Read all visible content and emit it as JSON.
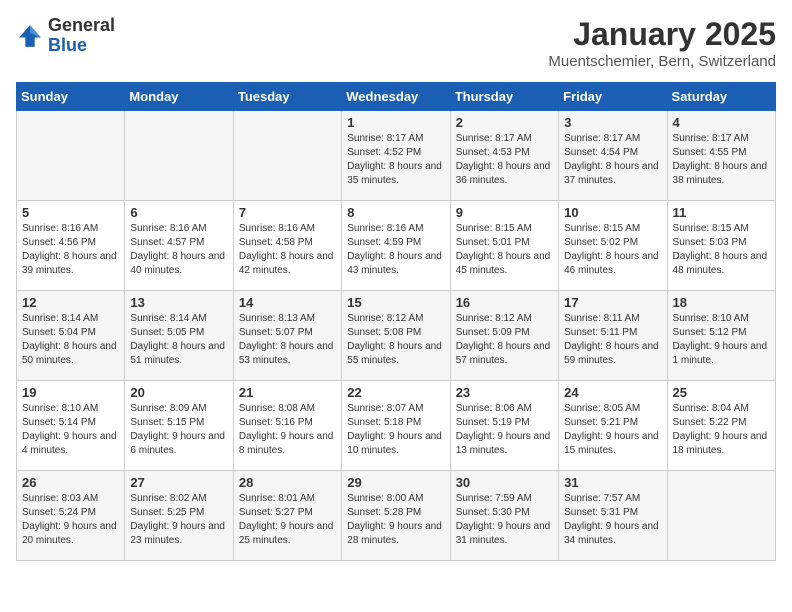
{
  "header": {
    "logo_general": "General",
    "logo_blue": "Blue",
    "month_title": "January 2025",
    "location": "Muentschemier, Bern, Switzerland"
  },
  "weekdays": [
    "Sunday",
    "Monday",
    "Tuesday",
    "Wednesday",
    "Thursday",
    "Friday",
    "Saturday"
  ],
  "weeks": [
    [
      {
        "day": "",
        "sunrise": "",
        "sunset": "",
        "daylight": ""
      },
      {
        "day": "",
        "sunrise": "",
        "sunset": "",
        "daylight": ""
      },
      {
        "day": "",
        "sunrise": "",
        "sunset": "",
        "daylight": ""
      },
      {
        "day": "1",
        "sunrise": "Sunrise: 8:17 AM",
        "sunset": "Sunset: 4:52 PM",
        "daylight": "Daylight: 8 hours and 35 minutes."
      },
      {
        "day": "2",
        "sunrise": "Sunrise: 8:17 AM",
        "sunset": "Sunset: 4:53 PM",
        "daylight": "Daylight: 8 hours and 36 minutes."
      },
      {
        "day": "3",
        "sunrise": "Sunrise: 8:17 AM",
        "sunset": "Sunset: 4:54 PM",
        "daylight": "Daylight: 8 hours and 37 minutes."
      },
      {
        "day": "4",
        "sunrise": "Sunrise: 8:17 AM",
        "sunset": "Sunset: 4:55 PM",
        "daylight": "Daylight: 8 hours and 38 minutes."
      }
    ],
    [
      {
        "day": "5",
        "sunrise": "Sunrise: 8:16 AM",
        "sunset": "Sunset: 4:56 PM",
        "daylight": "Daylight: 8 hours and 39 minutes."
      },
      {
        "day": "6",
        "sunrise": "Sunrise: 8:16 AM",
        "sunset": "Sunset: 4:57 PM",
        "daylight": "Daylight: 8 hours and 40 minutes."
      },
      {
        "day": "7",
        "sunrise": "Sunrise: 8:16 AM",
        "sunset": "Sunset: 4:58 PM",
        "daylight": "Daylight: 8 hours and 42 minutes."
      },
      {
        "day": "8",
        "sunrise": "Sunrise: 8:16 AM",
        "sunset": "Sunset: 4:59 PM",
        "daylight": "Daylight: 8 hours and 43 minutes."
      },
      {
        "day": "9",
        "sunrise": "Sunrise: 8:15 AM",
        "sunset": "Sunset: 5:01 PM",
        "daylight": "Daylight: 8 hours and 45 minutes."
      },
      {
        "day": "10",
        "sunrise": "Sunrise: 8:15 AM",
        "sunset": "Sunset: 5:02 PM",
        "daylight": "Daylight: 8 hours and 46 minutes."
      },
      {
        "day": "11",
        "sunrise": "Sunrise: 8:15 AM",
        "sunset": "Sunset: 5:03 PM",
        "daylight": "Daylight: 8 hours and 48 minutes."
      }
    ],
    [
      {
        "day": "12",
        "sunrise": "Sunrise: 8:14 AM",
        "sunset": "Sunset: 5:04 PM",
        "daylight": "Daylight: 8 hours and 50 minutes."
      },
      {
        "day": "13",
        "sunrise": "Sunrise: 8:14 AM",
        "sunset": "Sunset: 5:05 PM",
        "daylight": "Daylight: 8 hours and 51 minutes."
      },
      {
        "day": "14",
        "sunrise": "Sunrise: 8:13 AM",
        "sunset": "Sunset: 5:07 PM",
        "daylight": "Daylight: 8 hours and 53 minutes."
      },
      {
        "day": "15",
        "sunrise": "Sunrise: 8:12 AM",
        "sunset": "Sunset: 5:08 PM",
        "daylight": "Daylight: 8 hours and 55 minutes."
      },
      {
        "day": "16",
        "sunrise": "Sunrise: 8:12 AM",
        "sunset": "Sunset: 5:09 PM",
        "daylight": "Daylight: 8 hours and 57 minutes."
      },
      {
        "day": "17",
        "sunrise": "Sunrise: 8:11 AM",
        "sunset": "Sunset: 5:11 PM",
        "daylight": "Daylight: 8 hours and 59 minutes."
      },
      {
        "day": "18",
        "sunrise": "Sunrise: 8:10 AM",
        "sunset": "Sunset: 5:12 PM",
        "daylight": "Daylight: 9 hours and 1 minute."
      }
    ],
    [
      {
        "day": "19",
        "sunrise": "Sunrise: 8:10 AM",
        "sunset": "Sunset: 5:14 PM",
        "daylight": "Daylight: 9 hours and 4 minutes."
      },
      {
        "day": "20",
        "sunrise": "Sunrise: 8:09 AM",
        "sunset": "Sunset: 5:15 PM",
        "daylight": "Daylight: 9 hours and 6 minutes."
      },
      {
        "day": "21",
        "sunrise": "Sunrise: 8:08 AM",
        "sunset": "Sunset: 5:16 PM",
        "daylight": "Daylight: 9 hours and 8 minutes."
      },
      {
        "day": "22",
        "sunrise": "Sunrise: 8:07 AM",
        "sunset": "Sunset: 5:18 PM",
        "daylight": "Daylight: 9 hours and 10 minutes."
      },
      {
        "day": "23",
        "sunrise": "Sunrise: 8:06 AM",
        "sunset": "Sunset: 5:19 PM",
        "daylight": "Daylight: 9 hours and 13 minutes."
      },
      {
        "day": "24",
        "sunrise": "Sunrise: 8:05 AM",
        "sunset": "Sunset: 5:21 PM",
        "daylight": "Daylight: 9 hours and 15 minutes."
      },
      {
        "day": "25",
        "sunrise": "Sunrise: 8:04 AM",
        "sunset": "Sunset: 5:22 PM",
        "daylight": "Daylight: 9 hours and 18 minutes."
      }
    ],
    [
      {
        "day": "26",
        "sunrise": "Sunrise: 8:03 AM",
        "sunset": "Sunset: 5:24 PM",
        "daylight": "Daylight: 9 hours and 20 minutes."
      },
      {
        "day": "27",
        "sunrise": "Sunrise: 8:02 AM",
        "sunset": "Sunset: 5:25 PM",
        "daylight": "Daylight: 9 hours and 23 minutes."
      },
      {
        "day": "28",
        "sunrise": "Sunrise: 8:01 AM",
        "sunset": "Sunset: 5:27 PM",
        "daylight": "Daylight: 9 hours and 25 minutes."
      },
      {
        "day": "29",
        "sunrise": "Sunrise: 8:00 AM",
        "sunset": "Sunset: 5:28 PM",
        "daylight": "Daylight: 9 hours and 28 minutes."
      },
      {
        "day": "30",
        "sunrise": "Sunrise: 7:59 AM",
        "sunset": "Sunset: 5:30 PM",
        "daylight": "Daylight: 9 hours and 31 minutes."
      },
      {
        "day": "31",
        "sunrise": "Sunrise: 7:57 AM",
        "sunset": "Sunset: 5:31 PM",
        "daylight": "Daylight: 9 hours and 34 minutes."
      },
      {
        "day": "",
        "sunrise": "",
        "sunset": "",
        "daylight": ""
      }
    ]
  ]
}
